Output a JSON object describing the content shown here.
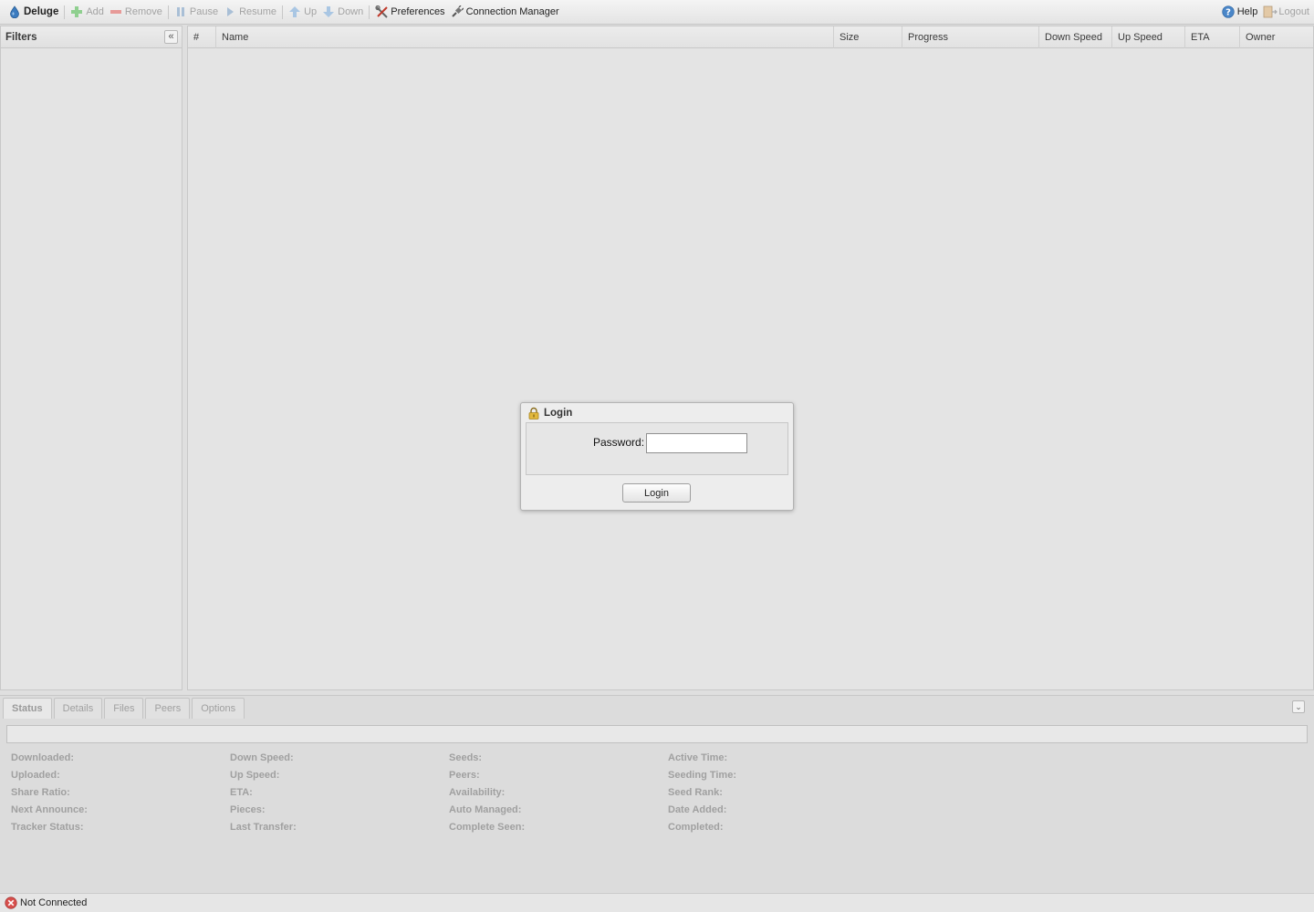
{
  "toolbar": {
    "brand": "Deluge",
    "add": "Add",
    "remove": "Remove",
    "pause": "Pause",
    "resume": "Resume",
    "up": "Up",
    "down": "Down",
    "preferences": "Preferences",
    "connection_manager": "Connection Manager",
    "help": "Help",
    "logout": "Logout"
  },
  "filters": {
    "title": "Filters"
  },
  "grid": {
    "columns": [
      "#",
      "Name",
      "Size",
      "Progress",
      "Down Speed",
      "Up Speed",
      "ETA",
      "Owner"
    ]
  },
  "login": {
    "title": "Login",
    "password_label": "Password:",
    "password_value": "",
    "button": "Login"
  },
  "details": {
    "tabs": [
      "Status",
      "Details",
      "Files",
      "Peers",
      "Options"
    ],
    "active_tab": "Status",
    "columns": [
      [
        "Downloaded:",
        "Uploaded:",
        "Share Ratio:",
        "Next Announce:",
        "Tracker Status:"
      ],
      [
        "Down Speed:",
        "Up Speed:",
        "ETA:",
        "Pieces:",
        "Last Transfer:"
      ],
      [
        "Seeds:",
        "Peers:",
        "Availability:",
        "Auto Managed:",
        "Complete Seen:"
      ],
      [
        "Active Time:",
        "Seeding Time:",
        "Seed Rank:",
        "Date Added:",
        "Completed:"
      ]
    ]
  },
  "status": {
    "connection": "Not Connected"
  },
  "colors": {
    "brand_blue": "#3b7bbf",
    "add_green": "#5cb85c",
    "remove_red": "#d9534f",
    "error_red": "#cc3333"
  }
}
